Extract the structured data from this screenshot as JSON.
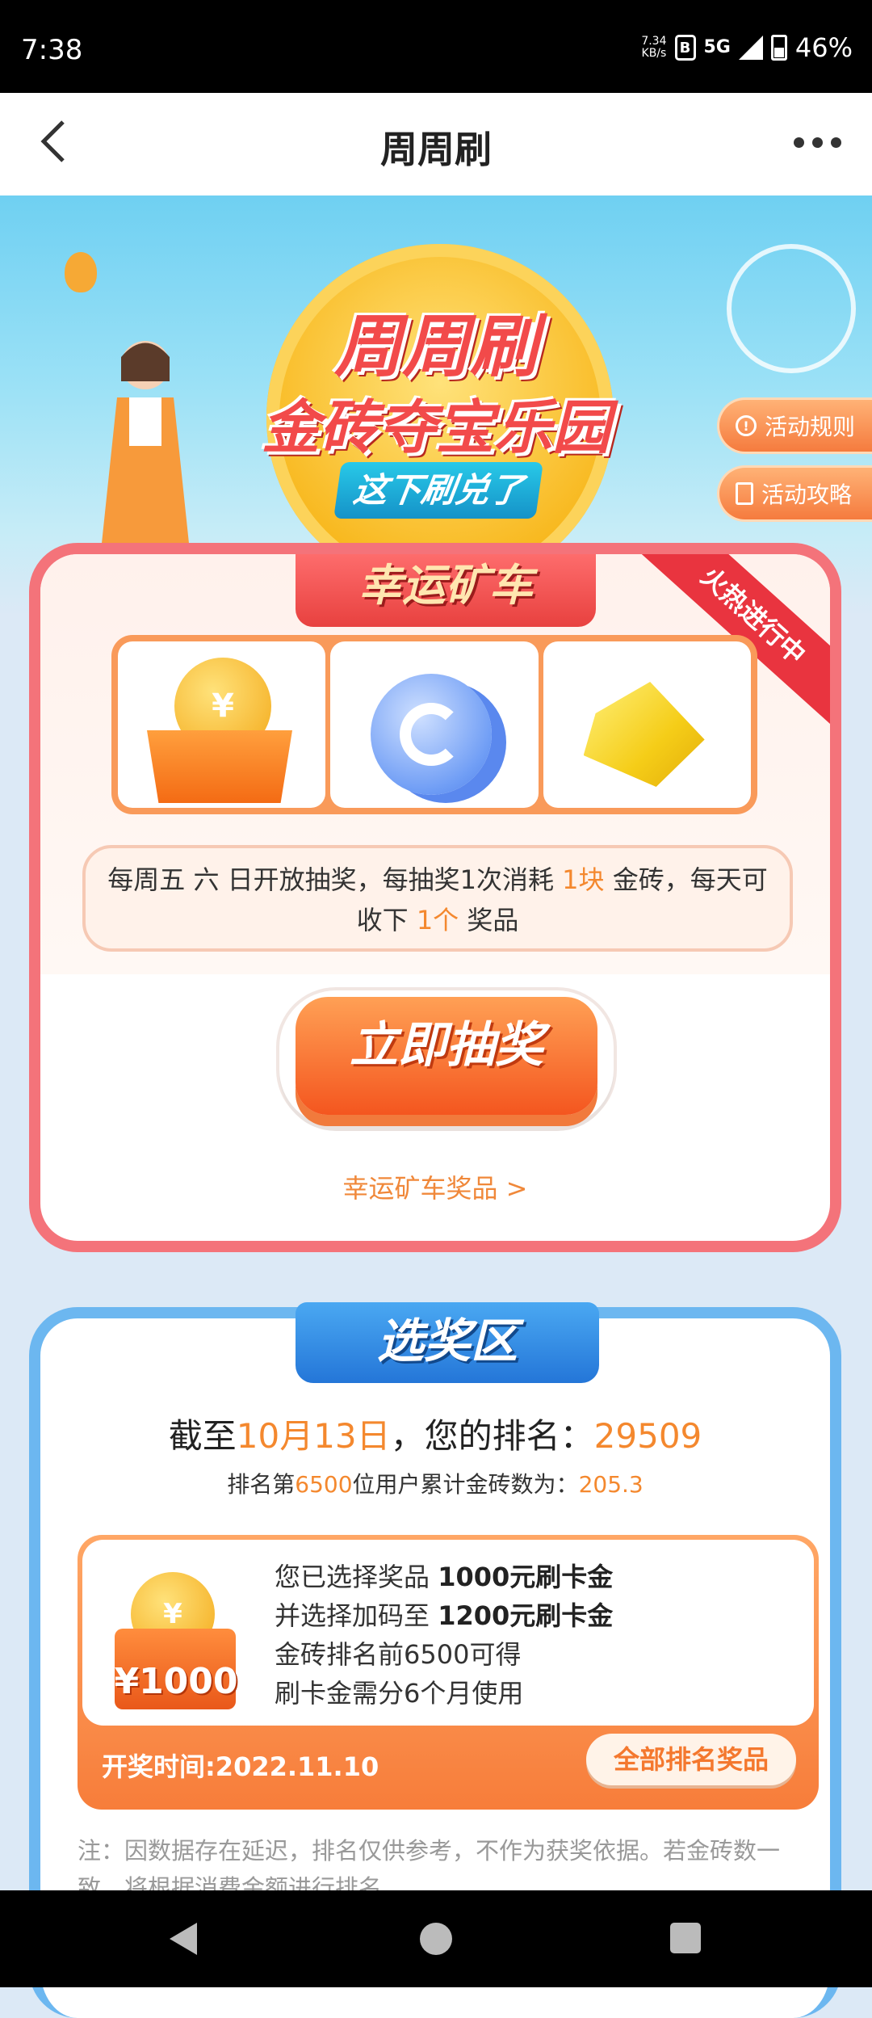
{
  "status_bar": {
    "time": "7:38",
    "speed_value": "7.34",
    "speed_unit": "KB/s",
    "network": "5G",
    "battery": "46%"
  },
  "nav": {
    "title": "周周刷"
  },
  "hero": {
    "title_line1": "周周刷",
    "title_line2": "金砖夺宝乐园",
    "slogan": "这下刷兑了",
    "rules_label": "活动规则",
    "guide_label": "活动攻略"
  },
  "lucky_cart": {
    "title": "幸运矿车",
    "badge": "火热进行中",
    "prizes": [
      {
        "icon": "gold-coin-box-icon"
      },
      {
        "icon": "blue-coin-stack-icon",
        "coin_glyph": "C"
      },
      {
        "icon": "gold-bar-icon"
      }
    ],
    "coin_glyph": "¥",
    "desc_part1": "每周五 六 日开放抽奖，每抽奖1次消耗",
    "desc_hl1": "1块",
    "desc_part2": "金砖，每天可收下",
    "desc_hl2": "1个",
    "desc_part3": "奖品",
    "draw_button": "立即抽奖",
    "prizes_link": "幸运矿车奖品 >"
  },
  "select_zone": {
    "title": "选奖区",
    "rank_prefix": "截至",
    "rank_date": "10月13日",
    "rank_middle": "，您的排名：",
    "rank_value": "29509",
    "sub_prefix": "排名第",
    "sub_rank": "6500",
    "sub_middle": "位用户累计金砖数为：",
    "sub_value": "205.3",
    "reward": {
      "coin_glyph": "¥",
      "amount": "¥1000",
      "line1_prefix": "您已选择奖品",
      "line1_bold": "1000元刷卡金",
      "line2_prefix": "并选择加码至",
      "line2_bold": "1200元刷卡金",
      "line3": "金砖排名前6500可得",
      "line4": "刷卡金需分6个月使用",
      "draw_time": "开奖时间:2022.11.10",
      "all_button": "全部排名奖品"
    },
    "note": "注：因数据存在延迟，排名仅供参考，不作为获奖依据。若金砖数一致，将根据消费金额进行排名。"
  }
}
